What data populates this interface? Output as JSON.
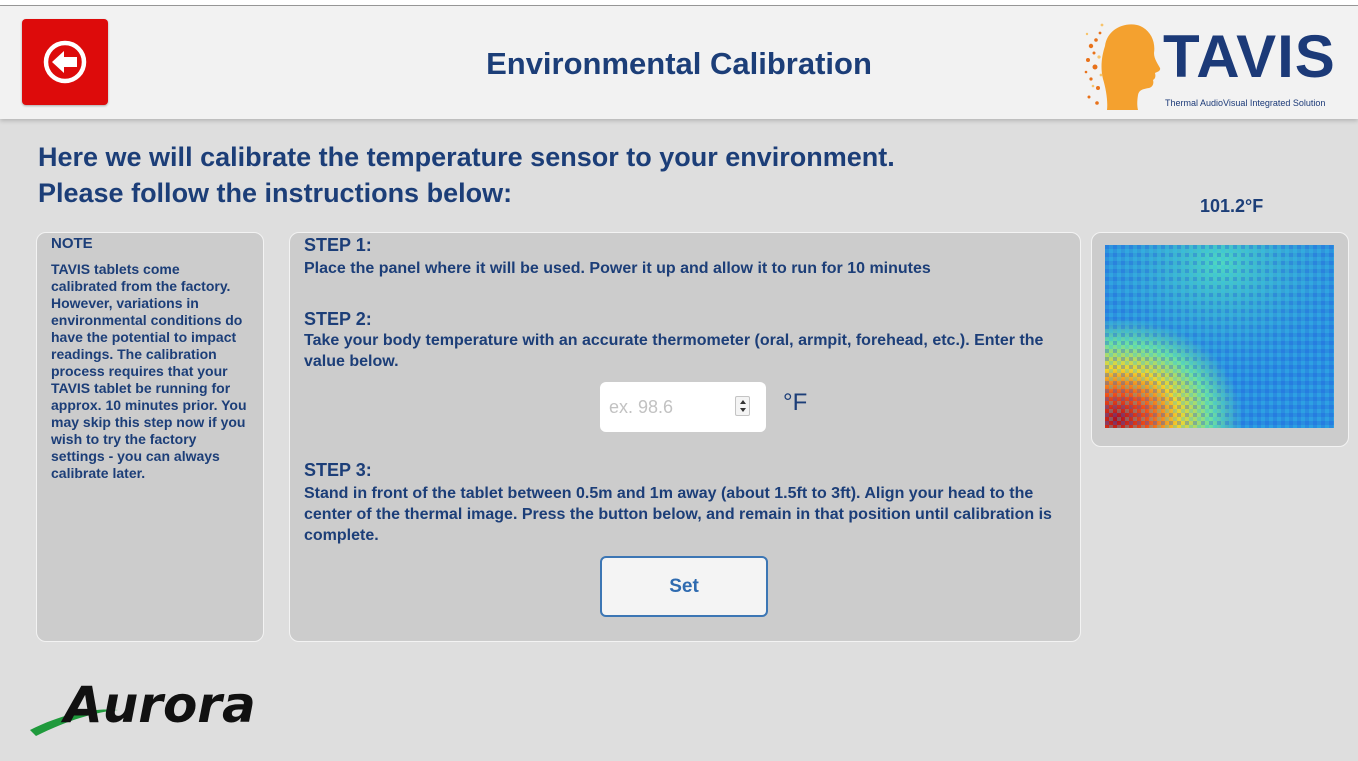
{
  "header": {
    "back_button": "back-arrow-icon",
    "title": "Environmental Calibration",
    "logo": {
      "name": "TAVIS",
      "tagline": "Thermal AudioVisual Integrated Solution"
    }
  },
  "intro": {
    "line1": "Here we will calibrate the temperature sensor to your environment.",
    "line2": "Please follow the instructions below:"
  },
  "sensor": {
    "temperature_readout": "101.2°F"
  },
  "note": {
    "title": "NOTE",
    "body": "TAVIS tablets come calibrated from the factory. However, variations in environmental conditions do have the potential to impact readings. The calibration process requires that your TAVIS tablet be running for approx. 10 minutes prior. You may skip this step now if you wish to try the factory settings - you can always calibrate later."
  },
  "steps": {
    "step1": {
      "title": "STEP 1:",
      "text": "Place the panel where it will be used.  Power it up and allow it to run for 10 minutes"
    },
    "step2": {
      "title": "STEP 2:",
      "text": "Take your body temperature with an accurate thermometer (oral, armpit, forehead, etc.).  Enter the value below.",
      "input_value": "",
      "input_placeholder": "ex. 98.6",
      "unit": "°F"
    },
    "step3": {
      "title": "STEP 3:",
      "text": "Stand in front of the tablet between 0.5m and 1m away (about 1.5ft to 3ft).  Align your head to the center of the thermal image.  Press the button below, and remain in that position until calibration is complete.",
      "button_label": "Set"
    }
  },
  "footer": {
    "logo": "Aurora"
  },
  "colors": {
    "background": "#dedede",
    "header_bg": "#f2f2f2",
    "primary_text": "#1c3e78",
    "back_button": "#dd0b0b",
    "panel_bg": "#cccccc",
    "set_button_border": "#3c76b4",
    "aurora_green": "#1f9a3c"
  }
}
